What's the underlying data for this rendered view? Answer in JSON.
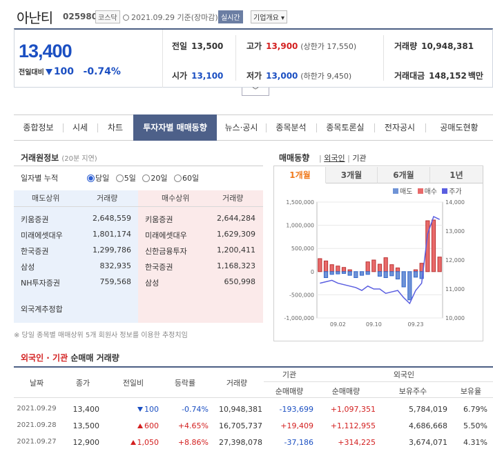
{
  "header": {
    "name": "아난티",
    "code": "025980",
    "market_badge": "코스닥",
    "date_text": "2021.09.29 기준(장마감)",
    "realtime_badge": "실시간",
    "company_button": "기업개요"
  },
  "price": {
    "current": "13,400",
    "change_label": "전일대비",
    "change_abs": "100",
    "change_pct": "-0.74%",
    "prev_label": "전일",
    "prev_value": "13,500",
    "open_label": "시가",
    "open_value": "13,100",
    "high_label": "고가",
    "high_value": "13,900",
    "high_sub": "(상한가 17,550)",
    "low_label": "저가",
    "low_value": "13,000",
    "low_sub": "(하한가 9,450)",
    "volume_label": "거래량",
    "volume_value": "10,948,381",
    "amount_label": "거래대금",
    "amount_value": "148,152",
    "amount_unit": "백만"
  },
  "tabs": [
    "종합정보",
    "시세",
    "차트",
    "투자자별 매매동향",
    "뉴스·공시",
    "종목분석",
    "종목토론실",
    "전자공시",
    "공매도현황"
  ],
  "broker": {
    "title": "거래원정보",
    "subtitle": "(20분 지연)",
    "period_label": "일자별 누적",
    "periods": [
      "당일",
      "5일",
      "20일",
      "60일"
    ],
    "sell_header": "매도상위",
    "sell_vol_header": "거래량",
    "buy_header": "매수상위",
    "buy_vol_header": "거래량",
    "sell": [
      {
        "name": "키움증권",
        "vol": "2,648,559"
      },
      {
        "name": "미래에셋대우",
        "vol": "1,801,174"
      },
      {
        "name": "한국증권",
        "vol": "1,299,786"
      },
      {
        "name": "삼성",
        "vol": "832,935"
      },
      {
        "name": "NH투자증권",
        "vol": "759,568"
      }
    ],
    "buy": [
      {
        "name": "키움증권",
        "vol": "2,644,284"
      },
      {
        "name": "미래에셋대우",
        "vol": "1,629,309"
      },
      {
        "name": "신한금융투자",
        "vol": "1,200,411"
      },
      {
        "name": "한국증권",
        "vol": "1,168,323"
      },
      {
        "name": "삼성",
        "vol": "650,998"
      }
    ],
    "foreign_estimate": "외국계추정합",
    "note": "※ 당일 종목별 매매상위 5개 회원사 정보를 이용한 추정치임"
  },
  "trend": {
    "title": "매매동향",
    "options": [
      "외국인",
      "기관"
    ],
    "periods": [
      "1개월",
      "3개월",
      "6개월",
      "1년"
    ],
    "legend": [
      "매도",
      "매수",
      "주가"
    ]
  },
  "colors": {
    "sell": "#6f93d6",
    "buy": "#e86a6a",
    "price": "#5a5ee0",
    "accent": "#1b4fc2",
    "up": "#d32020"
  },
  "chart_data": {
    "type": "bar",
    "title": "",
    "x_ticks": [
      "09.02",
      "09.10",
      "09.23"
    ],
    "y_left_ticks": [
      "1,500,000",
      "1,000,000",
      "500,000",
      "0",
      "-500,000",
      "-1,000,000"
    ],
    "y_left_range": [
      -1000000,
      1500000
    ],
    "y_right_ticks": [
      "14,000",
      "13,000",
      "12,000",
      "11,000",
      "10,000"
    ],
    "y_right_range": [
      10000,
      14000
    ],
    "series": [
      {
        "name": "매수",
        "values": [
          280000,
          230000,
          150000,
          120000,
          90000,
          40000,
          0,
          0,
          210000,
          250000,
          160000,
          300000,
          150000,
          80000,
          0,
          0,
          40000,
          180000,
          1097351,
          1112955,
          314225
        ]
      },
      {
        "name": "매도",
        "values": [
          0,
          -130000,
          -60000,
          -50000,
          -40000,
          -80000,
          -130000,
          -80000,
          -60000,
          0,
          -100000,
          -130000,
          -90000,
          -160000,
          -330000,
          -610000,
          -120000,
          -150000,
          0,
          0,
          0
        ]
      },
      {
        "name": "주가",
        "values": [
          11200,
          11250,
          11300,
          11200,
          11150,
          11100,
          11050,
          10950,
          11100,
          11000,
          11000,
          10850,
          10900,
          10950,
          10700,
          10500,
          10950,
          11200,
          12900,
          13500,
          13400
        ]
      }
    ]
  },
  "flow": {
    "title_a": "외국인 · 기관",
    "title_b": "순매매 거래량",
    "headers": {
      "date": "날짜",
      "close": "종가",
      "diff": "전일비",
      "rate": "등락률",
      "volume": "거래량",
      "inst": "기관",
      "inst_net": "순매매량",
      "foreign": "외국인",
      "foreign_net": "순매매량",
      "foreign_hold": "보유주수",
      "foreign_ratio": "보유율"
    },
    "rows": [
      {
        "date": "2021.09.29",
        "close": "13,400",
        "dir": "down",
        "diff": "100",
        "rate": "-0.74%",
        "volume": "10,948,381",
        "inst_net": "-193,699",
        "foreign_net": "+1,097,351",
        "hold": "5,784,019",
        "ratio": "6.79%"
      },
      {
        "date": "2021.09.28",
        "close": "13,500",
        "dir": "up",
        "diff": "600",
        "rate": "+4.65%",
        "volume": "16,705,737",
        "inst_net": "+19,409",
        "foreign_net": "+1,112,955",
        "hold": "4,686,668",
        "ratio": "5.50%"
      },
      {
        "date": "2021.09.27",
        "close": "12,900",
        "dir": "up",
        "diff": "1,050",
        "rate": "+8.86%",
        "volume": "27,398,078",
        "inst_net": "-37,186",
        "foreign_net": "+314,225",
        "hold": "3,674,071",
        "ratio": "4.31%"
      }
    ]
  }
}
